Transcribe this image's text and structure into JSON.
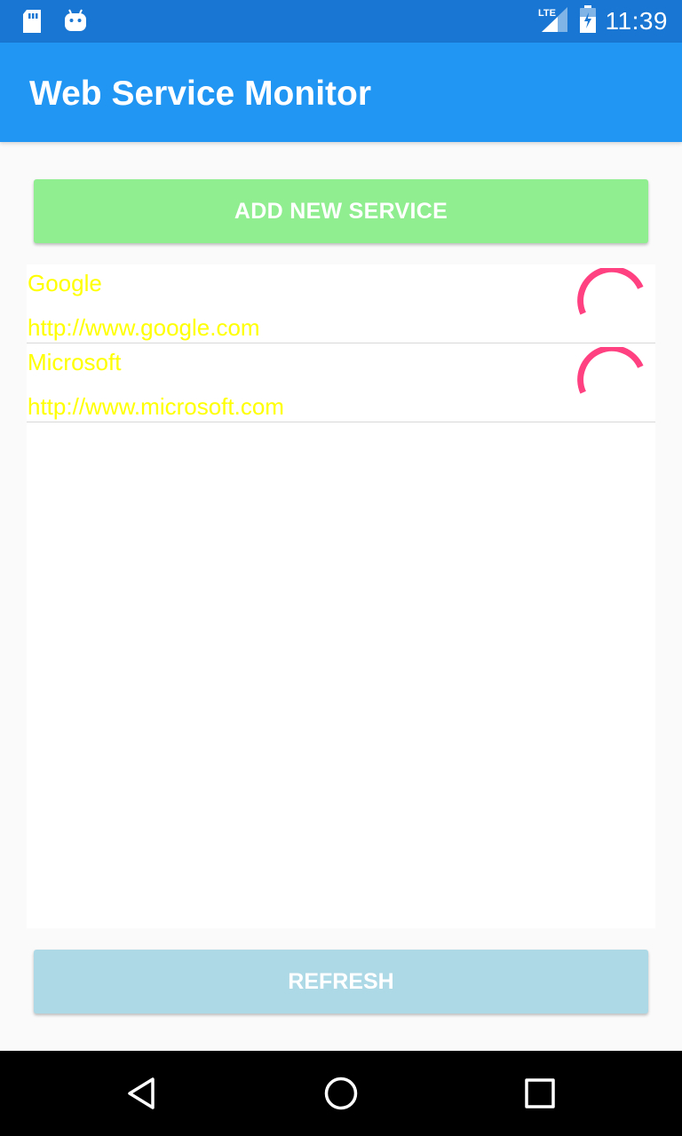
{
  "status_bar": {
    "time": "11:39",
    "network": "LTE",
    "left_icons": [
      "sd-card-icon",
      "android-icon"
    ],
    "right_icons": [
      "signal-icon",
      "battery-icon"
    ]
  },
  "app_bar": {
    "title": "Web Service Monitor",
    "color": "#2196f3"
  },
  "actions": {
    "add_label": "ADD NEW SERVICE",
    "refresh_label": "REFRESH"
  },
  "services": [
    {
      "name": "Google",
      "url": "http://www.google.com",
      "status": "loading"
    },
    {
      "name": "Microsoft",
      "url": "http://www.microsoft.com",
      "status": "loading"
    }
  ],
  "colors": {
    "add_button": "#90ee90",
    "refresh_button": "#add8e6",
    "item_text": "#ffff00",
    "spinner": "#ff4081",
    "status_bar": "#1976d2"
  },
  "nav_bar": {
    "icons": [
      "back-icon",
      "home-icon",
      "recents-icon"
    ]
  }
}
